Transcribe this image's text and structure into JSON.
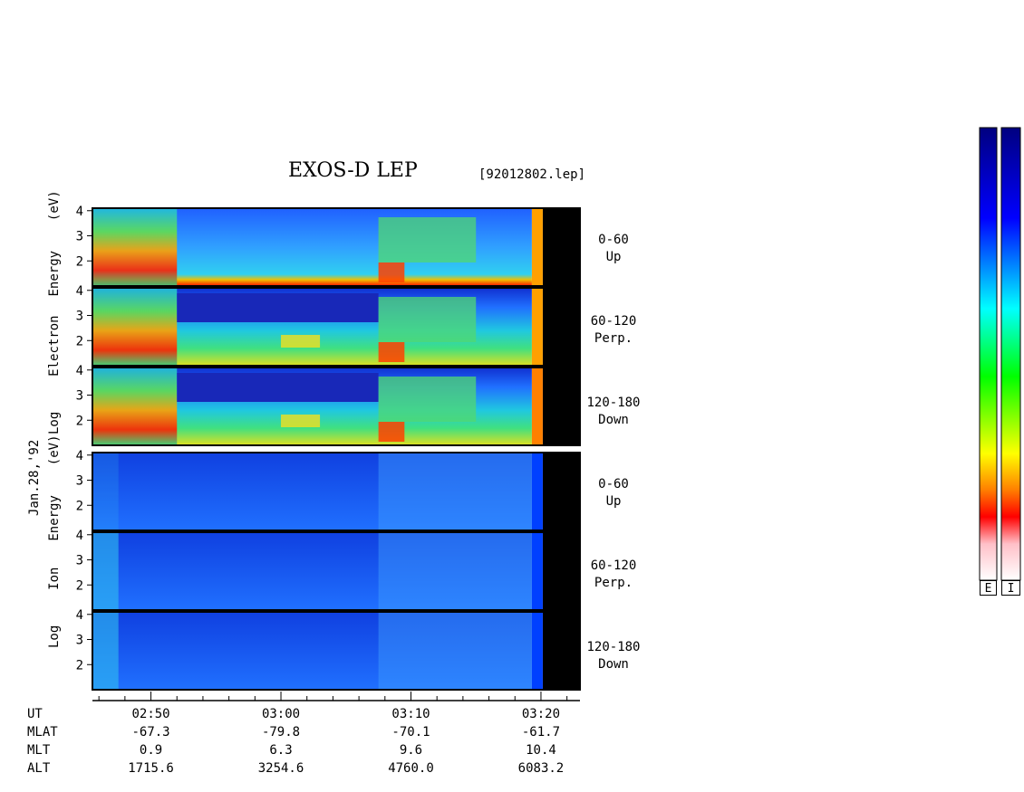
{
  "header": {
    "title": "EXOS-D LEP",
    "filename": "[92012802.lep]",
    "date": "Jan.28,'92"
  },
  "colors": {
    "background": "#ffffff",
    "separator": "#ffffff",
    "no_data": "#000000",
    "colorbar": [
      "#ffffff",
      "#ffc0c8",
      "#ff0000",
      "#ff8000",
      "#ffff00",
      "#00ff00",
      "#00ffff",
      "#0000ff",
      "#000080"
    ]
  },
  "colorbar_labels": [
    "E",
    "I"
  ],
  "chart_data": {
    "type": "heatmap",
    "groups": [
      {
        "species": "Electron",
        "ylabel_words": [
          "Log",
          "Electron",
          "Energy",
          "(eV)"
        ],
        "panels": [
          {
            "angle_range": "0-60",
            "direction": "Up"
          },
          {
            "angle_range": "60-120",
            "direction": "Perp."
          },
          {
            "angle_range": "120-180",
            "direction": "Down"
          }
        ]
      },
      {
        "species": "Ion",
        "ylabel_words": [
          "Log",
          "Ion",
          "Energy",
          "(eV)"
        ],
        "panels": [
          {
            "angle_range": "0-60",
            "direction": "Up"
          },
          {
            "angle_range": "60-120",
            "direction": "Perp."
          },
          {
            "angle_range": "120-180",
            "direction": "Down"
          }
        ]
      }
    ],
    "yticks": [
      "4",
      "3",
      "2"
    ],
    "ylim": [
      1,
      4.1
    ],
    "xlim_minutes": [
      45.5,
      83
    ],
    "xticks": [
      "02:50",
      "03:00",
      "03:10",
      "03:20"
    ],
    "data_end_minute": 79.3,
    "footer": {
      "labels": [
        "UT",
        "MLAT",
        "MLT",
        "ALT"
      ],
      "columns": [
        {
          "UT": "02:50",
          "MLAT": "-67.3",
          "MLT": "0.9",
          "ALT": "1715.6"
        },
        {
          "UT": "03:00",
          "MLAT": "-79.8",
          "MLT": "6.3",
          "ALT": "3254.6"
        },
        {
          "UT": "03:10",
          "MLAT": "-70.1",
          "MLT": "9.6",
          "ALT": "4760.0"
        },
        {
          "UT": "03:20",
          "MLAT": "-61.7",
          "MLT": "10.4",
          "ALT": "6083.2"
        }
      ]
    }
  }
}
